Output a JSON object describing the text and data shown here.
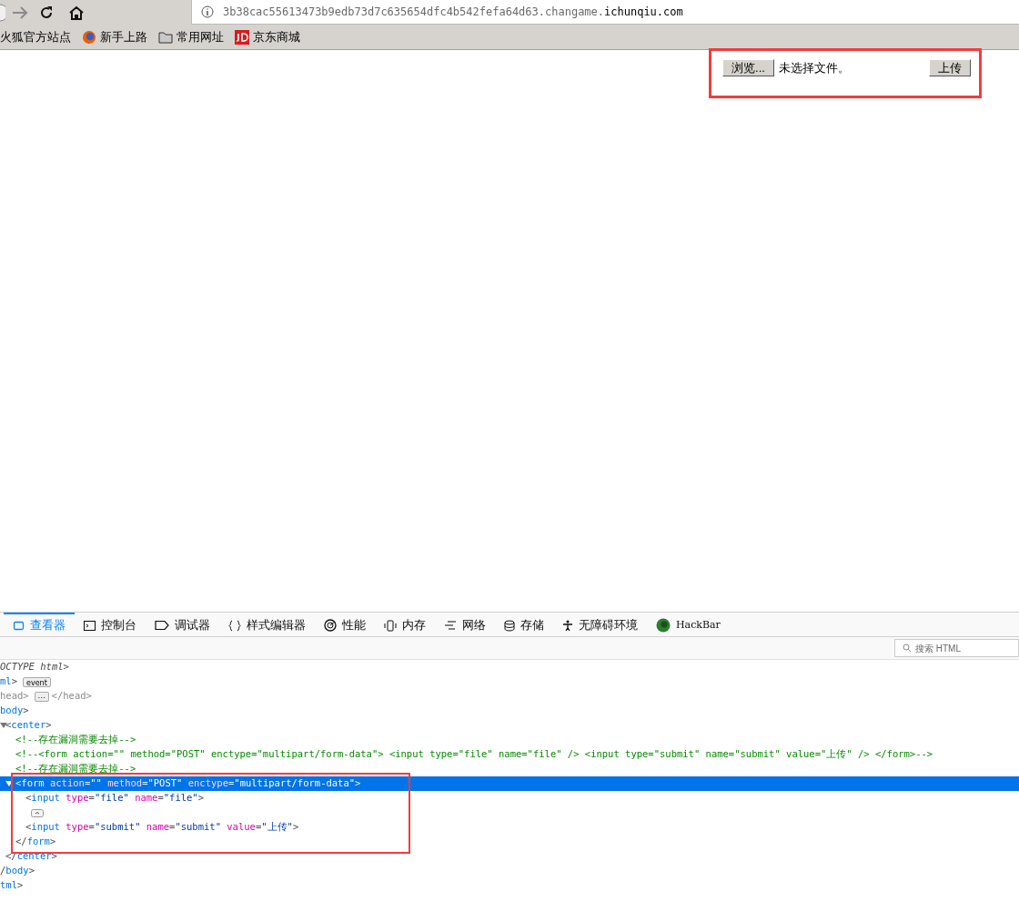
{
  "toolbar": {
    "url": [
      {
        "text": "3b38cac55613473b9edb73d7c635654dfc4b542fefa64d63.changame.",
        "emphasis": false
      },
      {
        "text": "ichunqiu.com",
        "emphasis": true
      }
    ]
  },
  "bookmarks": [
    {
      "label": "火狐官方站点"
    },
    {
      "label": "新手上路"
    },
    {
      "label": "常用网址"
    },
    {
      "label": "京东商城"
    }
  ],
  "page": {
    "browse_button": "浏览...",
    "file_status": "未选择文件。",
    "submit_button": "上传"
  },
  "devtools": {
    "tabs": [
      {
        "label": "查看器",
        "selected": true
      },
      {
        "label": "控制台",
        "selected": false
      },
      {
        "label": "调试器",
        "selected": false
      },
      {
        "label": "样式编辑器",
        "selected": false
      },
      {
        "label": "性能",
        "selected": false
      },
      {
        "label": "内存",
        "selected": false
      },
      {
        "label": "网络",
        "selected": false
      },
      {
        "label": "存储",
        "selected": false
      },
      {
        "label": "无障碍环境",
        "selected": false
      },
      {
        "label": "HackBar",
        "selected": false
      }
    ],
    "search": {
      "placeholder": "搜索 HTML"
    },
    "tree": [
      {
        "tokens": [
          {
            "kind": "doctype",
            "text": "OCTYPE html>"
          }
        ]
      },
      {
        "tokens": [
          {
            "kind": "tag",
            "text": "ml"
          },
          {
            "kind": "punct",
            "text": ">"
          }
        ],
        "badge": "event",
        "closing": [
          {
            "kind": "tag",
            "text": "tml"
          },
          {
            "kind": "punct",
            "text": ">"
          }
        ],
        "children": [
          {
            "tokens": [
              {
                "kind": "dim",
                "text": "head>"
              }
            ],
            "badge": "⋯",
            "tail": [
              {
                "kind": "dim",
                "text": "</head>"
              }
            ]
          },
          {
            "tokens": [
              {
                "kind": "tag",
                "text": "body"
              },
              {
                "kind": "punct",
                "text": ">"
              }
            ],
            "closing": [
              {
                "kind": "punct",
                "text": "/"
              },
              {
                "kind": "tag",
                "text": "body"
              },
              {
                "kind": "punct",
                "text": ">"
              }
            ],
            "children": [
              {
                "expanded": true,
                "selected": false,
                "tokens": [
                  {
                    "kind": "punct",
                    "text": "<"
                  },
                  {
                    "kind": "tag",
                    "text": "center"
                  },
                  {
                    "kind": "punct",
                    "text": ">"
                  }
                ],
                "closing": [
                  {
                    "kind": "punct",
                    "text": "</"
                  },
                  {
                    "kind": "tag",
                    "text": "center"
                  },
                  {
                    "kind": "punct",
                    "text": ">"
                  }
                ],
                "children": [
                  {
                    "tokens": [
                      {
                        "kind": "comment",
                        "text": "<!--存在漏洞需要去掉-->"
                      }
                    ]
                  },
                  {
                    "tokens": [
                      {
                        "kind": "comment",
                        "text": "<!--<form action=\"\" method=\"POST\" enctype=\"multipart/form-data\"> <input type=\"file\" name=\"file\" /> <input type=\"submit\" name=\"submit\" value=\"上传\" /> </form>-->"
                      }
                    ]
                  },
                  {
                    "tokens": [
                      {
                        "kind": "comment",
                        "text": "<!--存在漏洞需要去掉-->"
                      }
                    ]
                  },
                  {
                    "expanded": true,
                    "selected": true,
                    "tokens": [
                      {
                        "kind": "punct",
                        "text": "<"
                      },
                      {
                        "kind": "tag",
                        "text": "form"
                      },
                      {
                        "kind": "attr",
                        "text": " action"
                      },
                      {
                        "kind": "punct",
                        "text": "="
                      },
                      {
                        "kind": "value",
                        "text": "\"\""
                      },
                      {
                        "kind": "attr",
                        "text": " method"
                      },
                      {
                        "kind": "punct",
                        "text": "="
                      },
                      {
                        "kind": "value",
                        "text": "\"POST\""
                      },
                      {
                        "kind": "attr",
                        "text": " enctype"
                      },
                      {
                        "kind": "punct",
                        "text": "="
                      },
                      {
                        "kind": "value",
                        "text": "\"multipart/form-data\""
                      },
                      {
                        "kind": "punct",
                        "text": ">"
                      }
                    ],
                    "closing": [
                      {
                        "kind": "punct",
                        "text": "</"
                      },
                      {
                        "kind": "tag",
                        "text": "form"
                      },
                      {
                        "kind": "punct",
                        "text": ">"
                      }
                    ],
                    "children": [
                      {
                        "tokens": [
                          {
                            "kind": "punct",
                            "text": "<"
                          },
                          {
                            "kind": "tag",
                            "text": "input"
                          },
                          {
                            "kind": "attr",
                            "text": " type"
                          },
                          {
                            "kind": "punct",
                            "text": "="
                          },
                          {
                            "kind": "value",
                            "text": "\"file\""
                          },
                          {
                            "kind": "attr",
                            "text": " name"
                          },
                          {
                            "kind": "punct",
                            "text": "="
                          },
                          {
                            "kind": "value",
                            "text": "\"file\""
                          },
                          {
                            "kind": "punct",
                            "text": ">"
                          }
                        ]
                      },
                      {
                        "kind": "whitespace"
                      },
                      {
                        "tokens": [
                          {
                            "kind": "punct",
                            "text": "<"
                          },
                          {
                            "kind": "tag",
                            "text": "input"
                          },
                          {
                            "kind": "attr",
                            "text": " type"
                          },
                          {
                            "kind": "punct",
                            "text": "="
                          },
                          {
                            "kind": "value",
                            "text": "\"submit\""
                          },
                          {
                            "kind": "attr",
                            "text": " name"
                          },
                          {
                            "kind": "punct",
                            "text": "="
                          },
                          {
                            "kind": "value",
                            "text": "\"submit\""
                          },
                          {
                            "kind": "attr",
                            "text": " value"
                          },
                          {
                            "kind": "punct",
                            "text": "="
                          },
                          {
                            "kind": "value",
                            "text": "\"上传\""
                          },
                          {
                            "kind": "punct",
                            "text": ">"
                          }
                        ]
                      }
                    ]
                  }
                ]
              }
            ]
          }
        ]
      }
    ]
  }
}
